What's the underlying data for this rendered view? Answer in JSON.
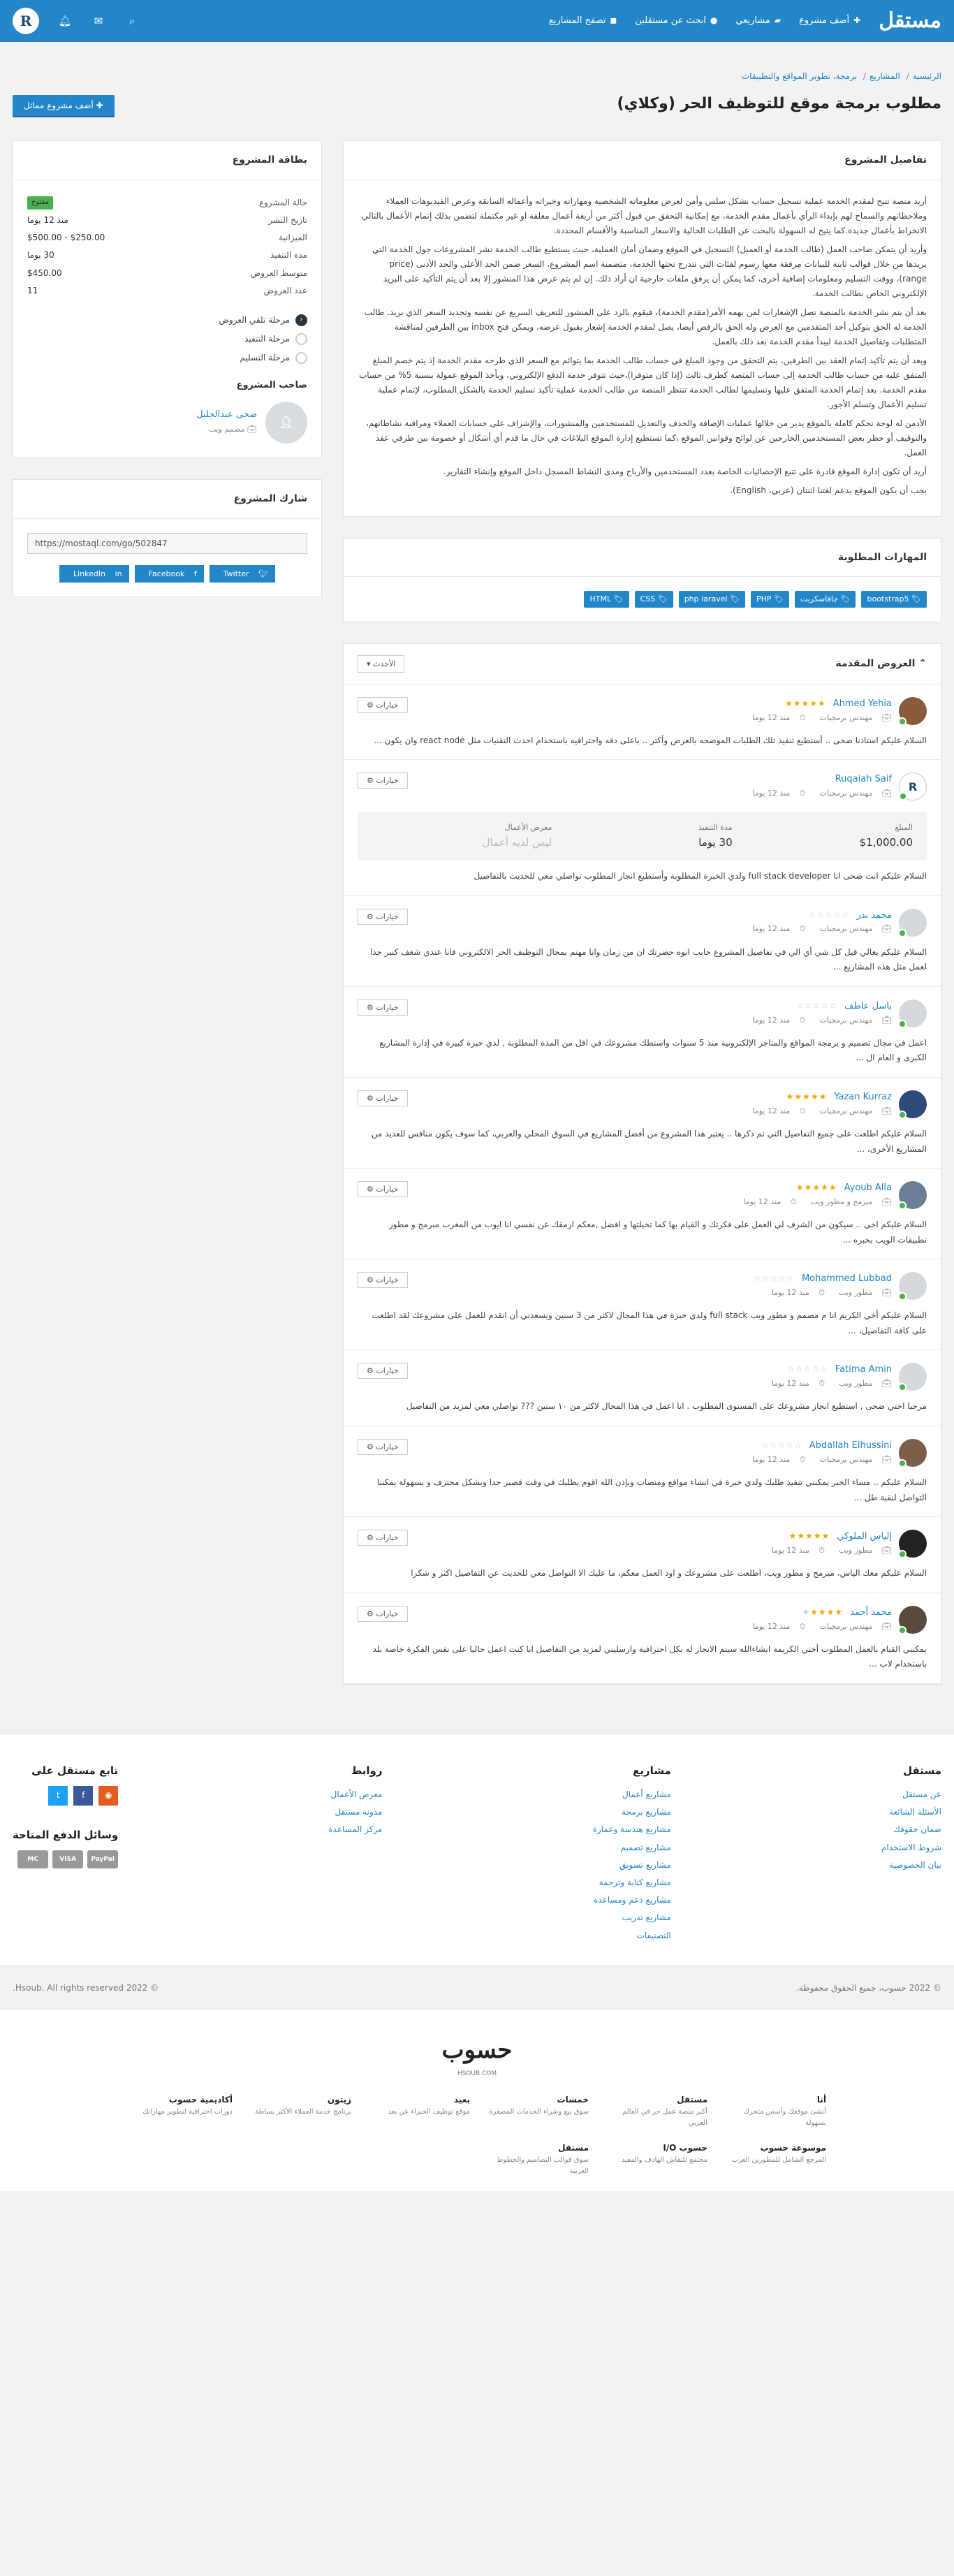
{
  "nav": {
    "logo": "مستقل",
    "items": [
      {
        "label": "أضف مشروع",
        "icon": "plus-icon"
      },
      {
        "label": "مشاريعي",
        "icon": "folder-icon"
      },
      {
        "label": "ابحث عن مستقلين",
        "icon": "users-icon"
      },
      {
        "label": "تصفح المشاريع",
        "icon": "briefcase-icon"
      }
    ],
    "avatar_letter": "R"
  },
  "breadcrumb": [
    "الرئيسية",
    "المشاريع",
    "برمجة، تطوير المواقع والتطبيقات"
  ],
  "page_title": "مطلوب برمجة موقع للتوظيف الحر (وكلاي)",
  "add_similar_label": "أضف مشروع مماثل",
  "details": {
    "heading": "تفاصيل المشروع",
    "paragraphs": [
      "أريد منصة تتيح لمقدم الخدمة عملية تسجيل حساب بشكل سلس وأمن لعرض معلوماته الشخصية ومهاراته وخبراته وأعماله السابقة وعرض الفيديوهات العملاء وملاحظاتهم والسماح لهم بإبداء الرأي بأعمال مقدم الخدمة، مع إمكانية التحقق من قبول أكثر من أربعة أعمال معلقة او غير مكتملة لتضمن بذلك إتمام الأعمال بالتالي الانخراط بأعمال جديدة.كما يتيح له السهولة بالبحث عن الطلبات الحالية والاسعار المناسبة والأقسام المحددة.",
      "وأريد أن يتمكن صاحب العمل (طالب الخدمة أو العميل) التسجيل في الموقع وضمان أمان العملية، حيث يستطيع طالب الخدمة نشر المشروعات جول الخدمة التي يريدها من خلال قوالب ثابتة للبيانات مرفقة معها رسوم لفئات التي تتدرج تحتها الخدمة، متضمنة اسم المشروع، السعر ضمن الحد الأعلى والحد الأدنى (price range)، ووقت التسليم ومعلومات إضافية أخرى، كما يمكن أن يرفق ملفات خارجية ان أراد ذلك. إن لم يتم عرض هذا المنشور إلا بعد أن يتم التأكيد على البريد الإلكتروني الخاص بطالب الخدمة.",
      "بعد أن يتم نشر الخدمة بالمنصة تصل الإشعارات لمن يهمه الأمر(مقدم الخدمة)، فيقوم بالرد على المنشور للتعريف السريع عن نفسه وتحديد السعر الذي يريد. طالب الخدمة له الحق بتوكيل أحد المتقدمين مع العرض وله الحق بالرفض أيضا، يصل لمقدم الخدمة إشعار بقبول عرضه، ويمكن فتح inbox بين الطرفين لمناقشة المتطلبات وتفاصيل الخدمة ليبدأ مقدم الخدمة بعد ذلك بالعمل.",
      "وبعد أن يتم تأكيد إتمام العقد بين الطرفين، يتم التحقق من وجود المبلغ في حساب طالب الخدمة بما يتوائم مع السعر الذي طرحه مقدم الخدمة إذ يتم خصم المبلغ المتفق عليه من حساب طالب الخدمة إلى حساب المنصة كطرف ثالث (إذا كان متوفرا)،حيث تتوفر خدمة الدفع الإلكتروني، ويأخذ الموقع عمولة بنسبة 5% من حساب مقدم الخدمة. بعد إتمام الخدمة المتفق عليها وتسليمها لطالب الخدمة تنتظر المنصة من طالب الخدمة عملية تأكيد تسليم الخدمة بالشكل المطلوب، لإتمام عملية تسليم الأعمال وتسلم الأجور.",
      "الأدمن له لوحة تحكم كاملة بالموقع يدير من خلالها عمليات الإضافة والحذف والتعديل للمستخدمين والمنشورات، والإشراف على حسابات العملاء ومراقبة نشاطاتهم، والتوقيف أو حظر بعض المستخدمين الخارجين عن لوائح وقوانين الموقع ،كما تستطيع إدارة الموقع البلاغات في حال ما قدم أي أشكال أو خصومة بين طرفي عقد العمل.",
      "أريد أن تكون إدارة الموقع قادرة على تتبع الإحصائيات الخاصة بعدد المستخدمين والأرباح ومدى النشاط المسجل داخل الموقع وإنشاء التقارير.",
      "يجب أن يكون الموقع يدعم لغتنا اثنتان (عربي، English)."
    ]
  },
  "skills": {
    "heading": "المهارات المطلوبة",
    "tags": [
      "bootstrap5",
      "جافاسكربت",
      "PHP",
      "php laravel",
      "CSS",
      "HTML"
    ]
  },
  "offers": {
    "heading": "العروض المقدمة",
    "sort_label": "الأحدث",
    "options_label": "خيارات",
    "stats_labels": {
      "price": "المبلغ",
      "duration": "مدة التنفيذ",
      "portfolio": "معرض الأعمال"
    },
    "list": [
      {
        "name": "Ahmed Yehia",
        "stars": "★★★★★",
        "empty": "",
        "role": "مهندس برمجيات",
        "time": "منذ 12 يوما",
        "text": "السلام عليكم استاذنا ضحى .. أستطيع تنفيذ تلك الطلبات الموضحه بالعرض وأكثر .. باعلى دقه واحترافيه باستخدام احدث التقنيات مثل react node وان يكون ...",
        "avatar_color": "#8a5a3c",
        "letter": ""
      },
      {
        "name": "Ruqaiah Saif",
        "stars": "",
        "empty": "",
        "role": "مهندس برمجيات",
        "time": "منذ 12 يوما",
        "text": "السلام عليكم انت ضحى انا full stack developer ولدي الخبرة المطلوبة وأستطيع انجاز المطلوب تواصلي معي للحديث بالتفاصيل",
        "avatar_color": "#ffffff",
        "letter": "R",
        "stats": {
          "price": "$1,000.00",
          "duration": "30 يوما",
          "portfolio": "ليس لديه أعمال"
        }
      },
      {
        "name": "محمد بدر",
        "stars": "",
        "empty": "☆☆☆☆☆",
        "role": "مهندس برمجيات",
        "time": "منذ 12 يوما",
        "text": "السلام عليكم يغالي قبل كل شي أي الي في تفاصيل المشروع حابب انوه حضرتك ان من زمان وانا مهتم بمجال التوظيف الحر الالكتروني فانا عندي شغف كبير جدا لعمل مثل هذه المشاريع ...",
        "avatar_color": "#d5d9de",
        "letter": ""
      },
      {
        "name": "باسل عاطف",
        "stars": "",
        "empty": "☆☆☆☆☆",
        "role": "مهندس برمجيات",
        "time": "منذ 12 يوما",
        "text": "اعمل في مجال تصميم و برمجة المواقع والمتاجر الإلكترونية منذ 5 سنوات واستطك مشروعك في اقل من المدة المطلوبة , لدي خبرة كبيرة في إدارة المشاريع الكبرى و العام ال ...",
        "avatar_color": "#d5d9de",
        "letter": ""
      },
      {
        "name": "Yazan Kurraz",
        "stars": "★★★★★",
        "empty": "",
        "role": "مهندس برمجيات",
        "time": "منذ 12 يوما",
        "text": "السلام عليكم اطلعت على جميع التفاصيل التي تم ذكرها .. يعتبر هذا المشروع من أفضل المشاريع في السوق المحلي والعربي، كما سوف يكون منافس للعديد من المشاريع الأخرى، ...",
        "avatar_color": "#2c4a7a",
        "letter": ""
      },
      {
        "name": "Ayoub Alla",
        "stars": "★★★★★",
        "empty": "",
        "role": "مبرمج و مطور ويب",
        "time": "منذ 12 يوما",
        "text": "السلام عليكم اخي .. سيكون من الشرف لي العمل على فكرتك و القيام بها كما تخيلتها و افضل ,معكم ارمقك عن نفسي انا ايوب من المغرب مبرمج و مطور تطبيقات الويب بخبره ...",
        "avatar_color": "#6a7f96",
        "letter": ""
      },
      {
        "name": "Mohammed Lubbad",
        "stars": "",
        "empty": "☆☆☆☆☆",
        "role": "مطور ويب",
        "time": "منذ 12 يوما",
        "text": "السلام عليكم أخي الكريم انا م مصمم و مطور ويب full stack ولدي خبرة في هذا المجال لاكثر من 3 سنين ويسعدني أن اتقدم للعمل على مشروعك لقد اطلعت على كافة التفاصيل، ...",
        "avatar_color": "#d5d9de",
        "letter": ""
      },
      {
        "name": "Fatima Amin",
        "stars": "",
        "empty": "☆☆☆☆☆",
        "role": "مطور ويب",
        "time": "منذ 12 يوما",
        "text": "مرحبا اختي ضحى , استطيع انجاز مشروعك على المستوى المطلوب . انا اعمل في هذا المجال لاكثر من ١٠ سنين ??? تواصلي معي لمزيد من التفاصيل",
        "avatar_color": "#d5d9de",
        "letter": ""
      },
      {
        "name": "Abdallah Elhussini",
        "stars": "",
        "empty": "☆☆☆☆☆",
        "role": "مهندس برمجيات",
        "time": "منذ 12 يوما",
        "text": "السلام عليكم .. مساء الخير يمكنني تنفيذ طلبك ولدي خبرة في انشاء مواقع ومنصات وبإذن الله اقوم بطلبك في وقت قصير جدا وبشكل محترف و بسهولة يمكننا التواصل لنقبة طل ...",
        "avatar_color": "#7b5f4a",
        "letter": ""
      },
      {
        "name": "إلياس الملوكي",
        "stars": "★★★★★",
        "empty": "",
        "role": "مطور ويب",
        "time": "منذ 12 يوما",
        "text": "السلام عليكم معك الياس، مبرمج و مطور ويب، اطلعت على مشروعك و اود العمل معكم، ما عليك الا التواصل معي للحديث عن التفاصيل اكثر و شكرا",
        "avatar_color": "#222222",
        "letter": ""
      },
      {
        "name": "محمد أحمد",
        "stars": "★★★★",
        "empty": "★",
        "role": "مهندس برمجيات",
        "time": "منذ 12 يوما",
        "text": "يمكنني القيام بالعمل المطلوب أختي الكريمة انشاءالله سيتم الانجاز له بكل احترافية وارسليني لمزيد من التفاصيل انا كنت اعمل حاليا على نفس الفكرة خاصة بلد باستخدام لاب ...",
        "avatar_color": "#5a4a3c",
        "letter": ""
      }
    ]
  },
  "project_card": {
    "heading": "بطاقة المشروع",
    "rows": [
      {
        "k": "حالة المشروع",
        "v": "مفتوح",
        "badge": true
      },
      {
        "k": "تاريخ النشر",
        "v": "منذ 12 يوما"
      },
      {
        "k": "الميزانية",
        "v": "$250.00 - $500.00"
      },
      {
        "k": "مدة التنفيذ",
        "v": "30 يوما"
      },
      {
        "k": "متوسط العروض",
        "v": "$450.00"
      },
      {
        "k": "عدد العروض",
        "v": "11"
      }
    ],
    "stages": [
      {
        "label": "مرحلة تلقي العروض",
        "active": true
      },
      {
        "label": "مرحلة التنفيذ",
        "active": false
      },
      {
        "label": "مرحلة التسليم",
        "active": false
      }
    ],
    "owner_heading": "صاحب المشروع",
    "owner_name": "ضحى عبدالجليل",
    "owner_role": "مصمم ويب"
  },
  "share": {
    "heading": "شارك المشروع",
    "url": "https://mostaql.com/go/502847",
    "buttons": [
      "Twitter",
      "Facebook",
      "LinkedIn"
    ]
  },
  "footer": {
    "cols": [
      {
        "title": "مستقل",
        "links": [
          "عن مستقل",
          "الأسئلة الشائعة",
          "ضمان حقوقك",
          "شروط الاستخدام",
          "بيان الخصوصية"
        ]
      },
      {
        "title": "مشاريع",
        "links": [
          "مشاريع أعمال",
          "مشاريع برمجة",
          "مشاريع هندسة وعمارة",
          "مشاريع تصميم",
          "مشاريع تسويق",
          "مشاريع كتابة وترجمة",
          "مشاريع دعم ومساعدة",
          "مشاريع تدريب",
          "التصنيفات"
        ]
      },
      {
        "title": "روابط",
        "links": [
          "معرض الأعمال",
          "مدونة مستقل",
          "مركز المساعدة"
        ]
      }
    ],
    "follow_title": "تابع مستقل على",
    "pay_title": "وسائل الدفع المتاحة",
    "pay_methods": [
      "PayPal",
      "VISA",
      "MC"
    ],
    "copyright_ar": "© 2022 حسوب، جميع الحقوق محفوظة.",
    "copyright_en": "© 2022 Hsoub. All rights reserved."
  },
  "brand": {
    "logo": "حسوب",
    "sub": "HSOUB.COM",
    "items": [
      {
        "t": "أنا",
        "d": "أنشئ موقعك وأسس متجرك بسهولة"
      },
      {
        "t": "مستقل",
        "d": "أكبر منصة عمل حر في العالم العربي"
      },
      {
        "t": "خمسات",
        "d": "سوق بيع وشراء الخدمات المصغرة"
      },
      {
        "t": "بعيد",
        "d": "موقع توظيف الخبراء عن بعد"
      },
      {
        "t": "زيتون",
        "d": "برنامج خدمة العملاء الأكثر بساطة"
      },
      {
        "t": "أكاديمية حسوب",
        "d": "دورات احترافية لتطوير مهاراتك"
      },
      {
        "t": "موسوعة حسوب",
        "d": "المرجع الشامل للمطورين العرب"
      },
      {
        "t": "حسوب I/O",
        "d": "مجتمع للنقاش الهادف والمفيد"
      },
      {
        "t": "مستقل",
        "d": "سوق قوالب التصاميم والخطوط العربية"
      }
    ]
  }
}
